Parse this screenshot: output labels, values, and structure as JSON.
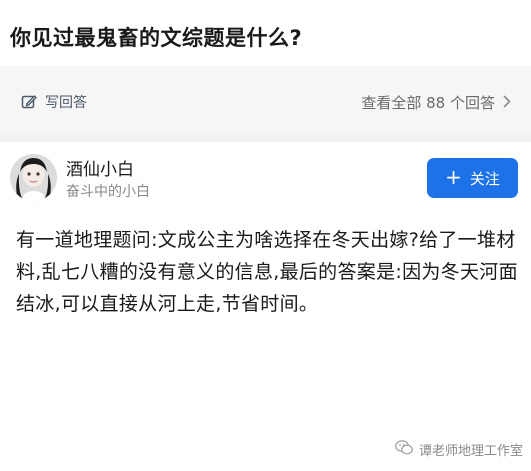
{
  "question": {
    "title": "你见过最鬼畜的文综题是什么?"
  },
  "toolbar": {
    "write_answer_label": "写回答",
    "view_all_label": "查看全部 88 个回答",
    "chevron_icon": "chevron-right-icon"
  },
  "author": {
    "name": "酒仙小白",
    "bio": "奋斗中的小白",
    "follow_label": "关注"
  },
  "answer": {
    "text": "有一道地理题问:文成公主为啥选择在冬天出嫁?给了一堆材料,乱七八糟的没有意义的信息,最后的答案是:因为冬天河面结冰,可以直接从河上走,节省时间。"
  },
  "watermark": {
    "label": "谭老师地理工作室"
  },
  "colors": {
    "accent": "#1e72e8",
    "toolbar_bg": "#f6f6f6",
    "muted_text": "#8a8a8a"
  }
}
